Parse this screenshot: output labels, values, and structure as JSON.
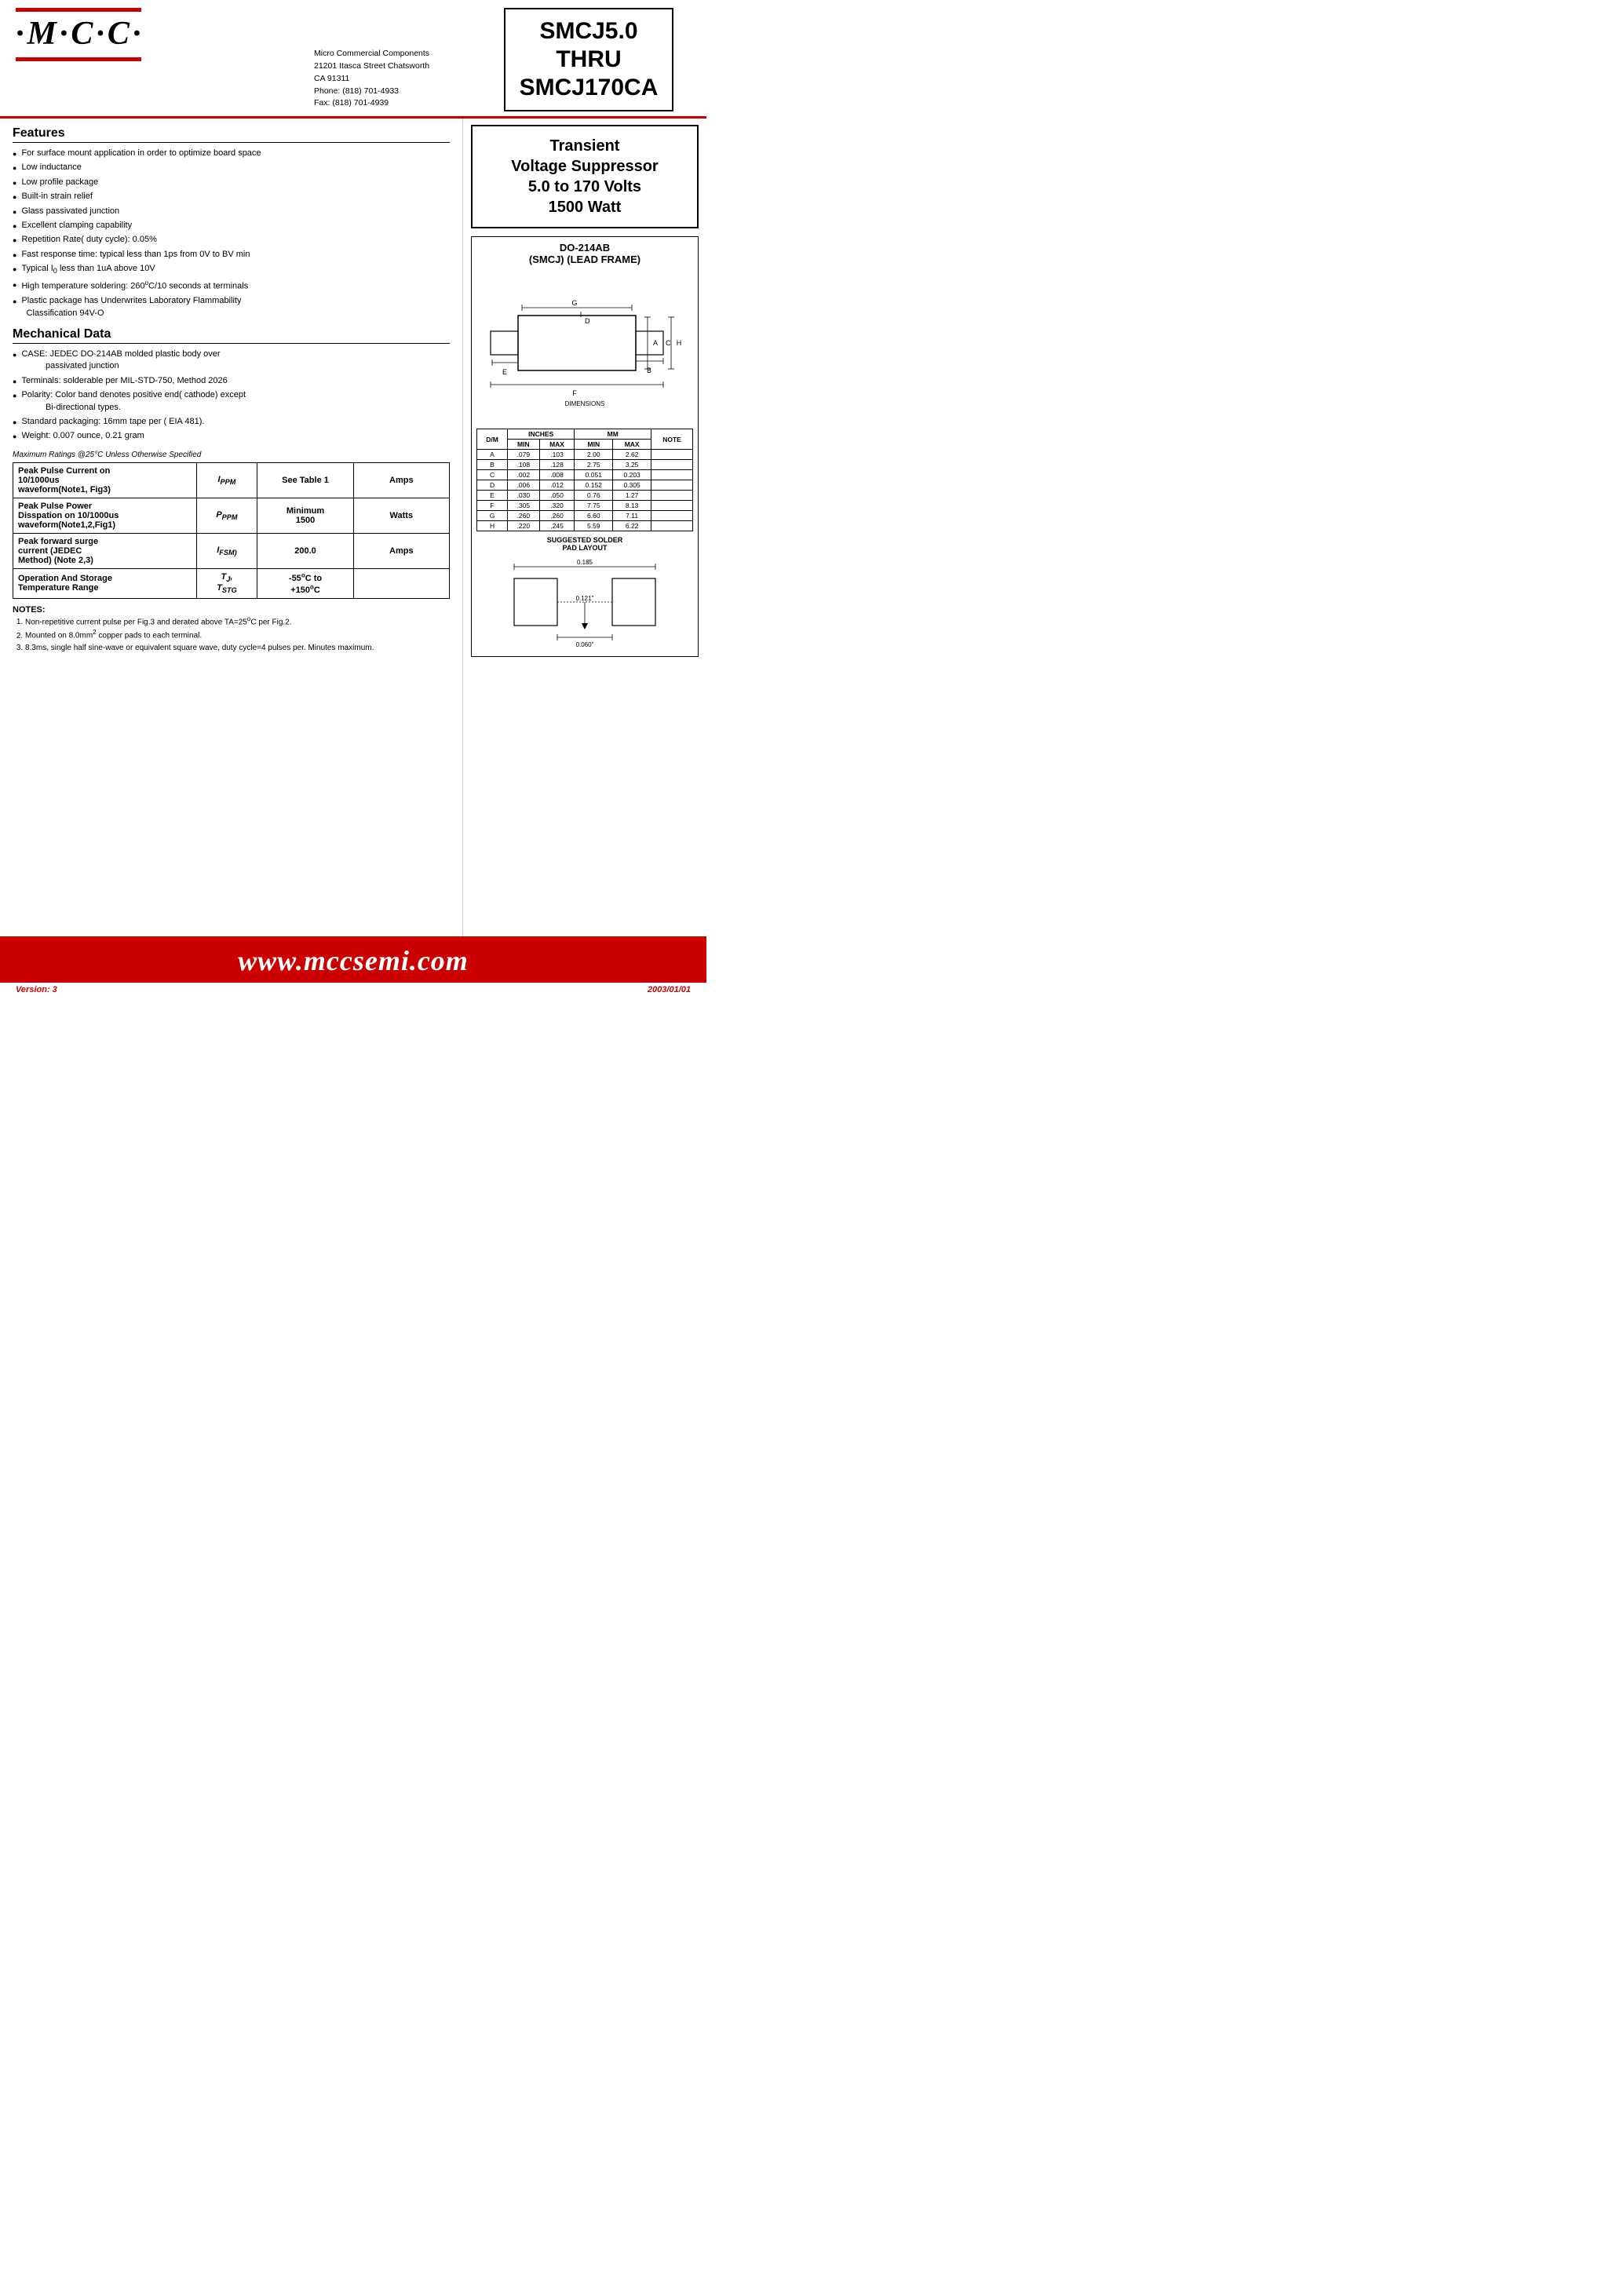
{
  "header": {
    "logo": "·M·C·C·",
    "company_name": "Micro Commercial Components",
    "address1": "21201 Itasca Street Chatsworth",
    "address2": "CA 91311",
    "phone": "Phone:  (818) 701-4933",
    "fax": "Fax:     (818) 701-4939",
    "part_number": "SMCJ5.0\nTHRU\nSMCJ170CA"
  },
  "transient": {
    "title": "Transient\nVoltage Suppressor\n5.0 to 170 Volts\n1500 Watt"
  },
  "package": {
    "title1": "DO-214AB",
    "title2": "(SMCJ) (LEAD FRAME)"
  },
  "features": {
    "title": "Features",
    "items": [
      "For surface mount application in order to optimize board space",
      "Low inductance",
      "Low profile package",
      "Built-in strain relief",
      "Glass passivated junction",
      "Excellent clamping capability",
      "Repetition Rate( duty cycle): 0.05%",
      "Fast response time: typical less than 1ps from 0V to BV min",
      "Typical I₀ less than 1uA above 10V",
      "High temperature soldering: 260°C/10 seconds at terminals",
      "Plastic package has Underwrites Laboratory Flammability Classification 94V-O"
    ]
  },
  "mechanical": {
    "title": "Mechanical Data",
    "items": [
      "CASE: JEDEC DO-214AB molded plastic body over passivated junction",
      "Terminals:  solderable per MIL-STD-750, Method 2026",
      "Polarity: Color band denotes positive end( cathode) except Bi-directional types.",
      "Standard packaging: 16mm tape per ( EIA 481).",
      "Weight: 0.007 ounce, 0.21 gram"
    ]
  },
  "ratings_title": "Maximum Ratings @25°C Unless Otherwise Specified",
  "ratings": [
    {
      "label": "Peak Pulse Current on 10/1000us waveform(Note1, Fig3)",
      "symbol": "IPPM",
      "value": "See Table 1",
      "unit": "Amps"
    },
    {
      "label": "Peak Pulse Power Disspation on 10/1000us waveform(Note1,2,Fig1)",
      "symbol": "PPPM",
      "value": "Minimum 1500",
      "unit": "Watts"
    },
    {
      "label": "Peak forward surge current (JEDEC Method) (Note 2,3)",
      "symbol": "IFSM)",
      "value": "200.0",
      "unit": "Amps"
    },
    {
      "label": "Operation And Storage Temperature Range",
      "symbol": "TJ, TSTG",
      "value": "-55°C to +150°C",
      "unit": ""
    }
  ],
  "notes": {
    "title": "NOTES:",
    "items": [
      "Non-repetitive current pulse per Fig.3 and derated above TA=25°C per Fig.2.",
      "Mounted on 8.0mm² copper pads to each terminal.",
      "8.3ms, single half sine-wave or equivalent square wave, duty cycle=4 pulses per. Minutes maximum."
    ]
  },
  "dim_table": {
    "headers": [
      "D/M",
      "MIN",
      "MAX",
      "MIN",
      "MAX",
      "NOTE"
    ],
    "subheaders": [
      "",
      "INCHES",
      "",
      "MM",
      "",
      ""
    ],
    "rows": [
      [
        "A",
        ".079",
        ".103",
        "2.00",
        "2.62",
        ""
      ],
      [
        "B",
        ".108",
        ".128",
        "2.75",
        "3.25",
        ""
      ],
      [
        "C",
        ".002",
        ".008",
        "0.051",
        "0.203",
        ""
      ],
      [
        "D",
        ".006",
        ".012",
        "0.152",
        "0.305",
        ""
      ],
      [
        "E",
        ".030",
        ".050",
        "0.76",
        "1.27",
        ""
      ],
      [
        "F",
        ".305",
        ".320",
        "7.75",
        "8.13",
        ""
      ],
      [
        "G",
        ".260",
        ".260",
        "6.60",
        "7.11",
        ""
      ],
      [
        "H",
        ".220",
        ".245",
        "5.59",
        "6.22",
        ""
      ]
    ]
  },
  "footer": {
    "url": "www.mccsemi.com",
    "version": "Version: 3",
    "date": "2003/01/01"
  }
}
